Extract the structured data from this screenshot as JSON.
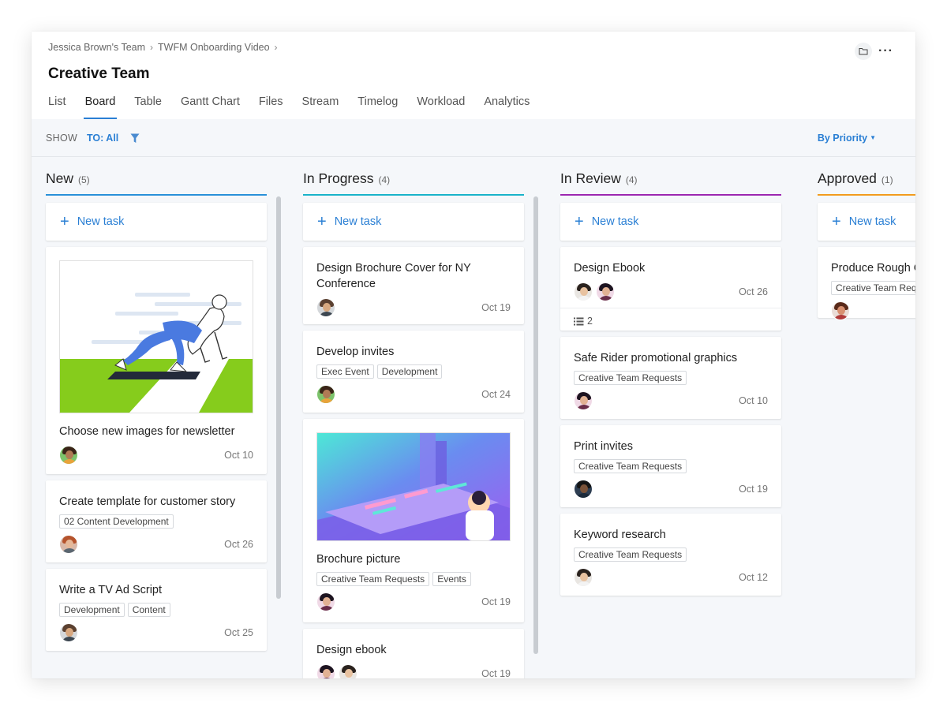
{
  "breadcrumb": {
    "team": "Jessica Brown's Team",
    "project": "TWFM Onboarding Video"
  },
  "title": "Creative Team",
  "tabs": [
    "List",
    "Board",
    "Table",
    "Gantt Chart",
    "Files",
    "Stream",
    "Timelog",
    "Workload",
    "Analytics"
  ],
  "active_tab": "Board",
  "toolbar": {
    "show_label": "SHOW",
    "to_all": "TO: All",
    "sort": "By Priority"
  },
  "new_task_label": "New task",
  "colors": {
    "accent": "#2a7fd4",
    "new": "#2a90d9",
    "in_progress": "#1ab3c9",
    "in_review": "#9c27b0",
    "approved": "#f29b1e"
  },
  "columns": [
    {
      "title": "New",
      "count": "(5)",
      "cards": [
        {
          "title": "Choose new images for newsletter",
          "image": "runner-illustration",
          "tags": [],
          "avatars": [
            "woman-curly"
          ],
          "date": "Oct 10"
        },
        {
          "title": "Create template for customer story",
          "tags": [
            "02 Content Development"
          ],
          "avatars": [
            "woman-red"
          ],
          "date": "Oct 26"
        },
        {
          "title": "Write a TV Ad Script",
          "tags": [
            "Development",
            "Content"
          ],
          "avatars": [
            "man-beard"
          ],
          "date": "Oct 25"
        }
      ]
    },
    {
      "title": "In Progress",
      "count": "(4)",
      "cards": [
        {
          "title": "Design Brochure Cover for NY Conference",
          "tags": [],
          "avatars": [
            "man-beard"
          ],
          "date": "Oct 19"
        },
        {
          "title": "Develop invites",
          "tags": [
            "Exec Event",
            "Development"
          ],
          "avatars": [
            "woman-curly"
          ],
          "date": "Oct 24"
        },
        {
          "title": "Brochure picture",
          "image": "factory-illustration",
          "tags": [
            "Creative Team Requests",
            "Events"
          ],
          "avatars": [
            "woman-dark"
          ],
          "date": "Oct 19"
        },
        {
          "title": "Design ebook",
          "tags": [],
          "avatars": [
            "woman-dark",
            "man-light"
          ],
          "date": "Oct 19"
        }
      ]
    },
    {
      "title": "In Review",
      "count": "(4)",
      "cards": [
        {
          "title": "Design Ebook",
          "tags": [],
          "avatars": [
            "man-light",
            "woman-dark"
          ],
          "date": "Oct 26",
          "subtasks": "2"
        },
        {
          "title": "Safe Rider promotional graphics",
          "tags": [
            "Creative Team Requests"
          ],
          "avatars": [
            "woman-dark"
          ],
          "date": "Oct 10"
        },
        {
          "title": "Print invites",
          "tags": [
            "Creative Team Requests"
          ],
          "avatars": [
            "man-dark"
          ],
          "date": "Oct 19"
        },
        {
          "title": "Keyword research",
          "tags": [
            "Creative Team Requests"
          ],
          "avatars": [
            "man-light"
          ],
          "date": "Oct 12"
        }
      ]
    },
    {
      "title": "Approved",
      "count": "(1)",
      "cards": [
        {
          "title": "Produce Rough Cut",
          "tags": [
            "Creative Team Requests"
          ],
          "avatars": [
            "man-red"
          ],
          "date": ""
        }
      ]
    }
  ]
}
